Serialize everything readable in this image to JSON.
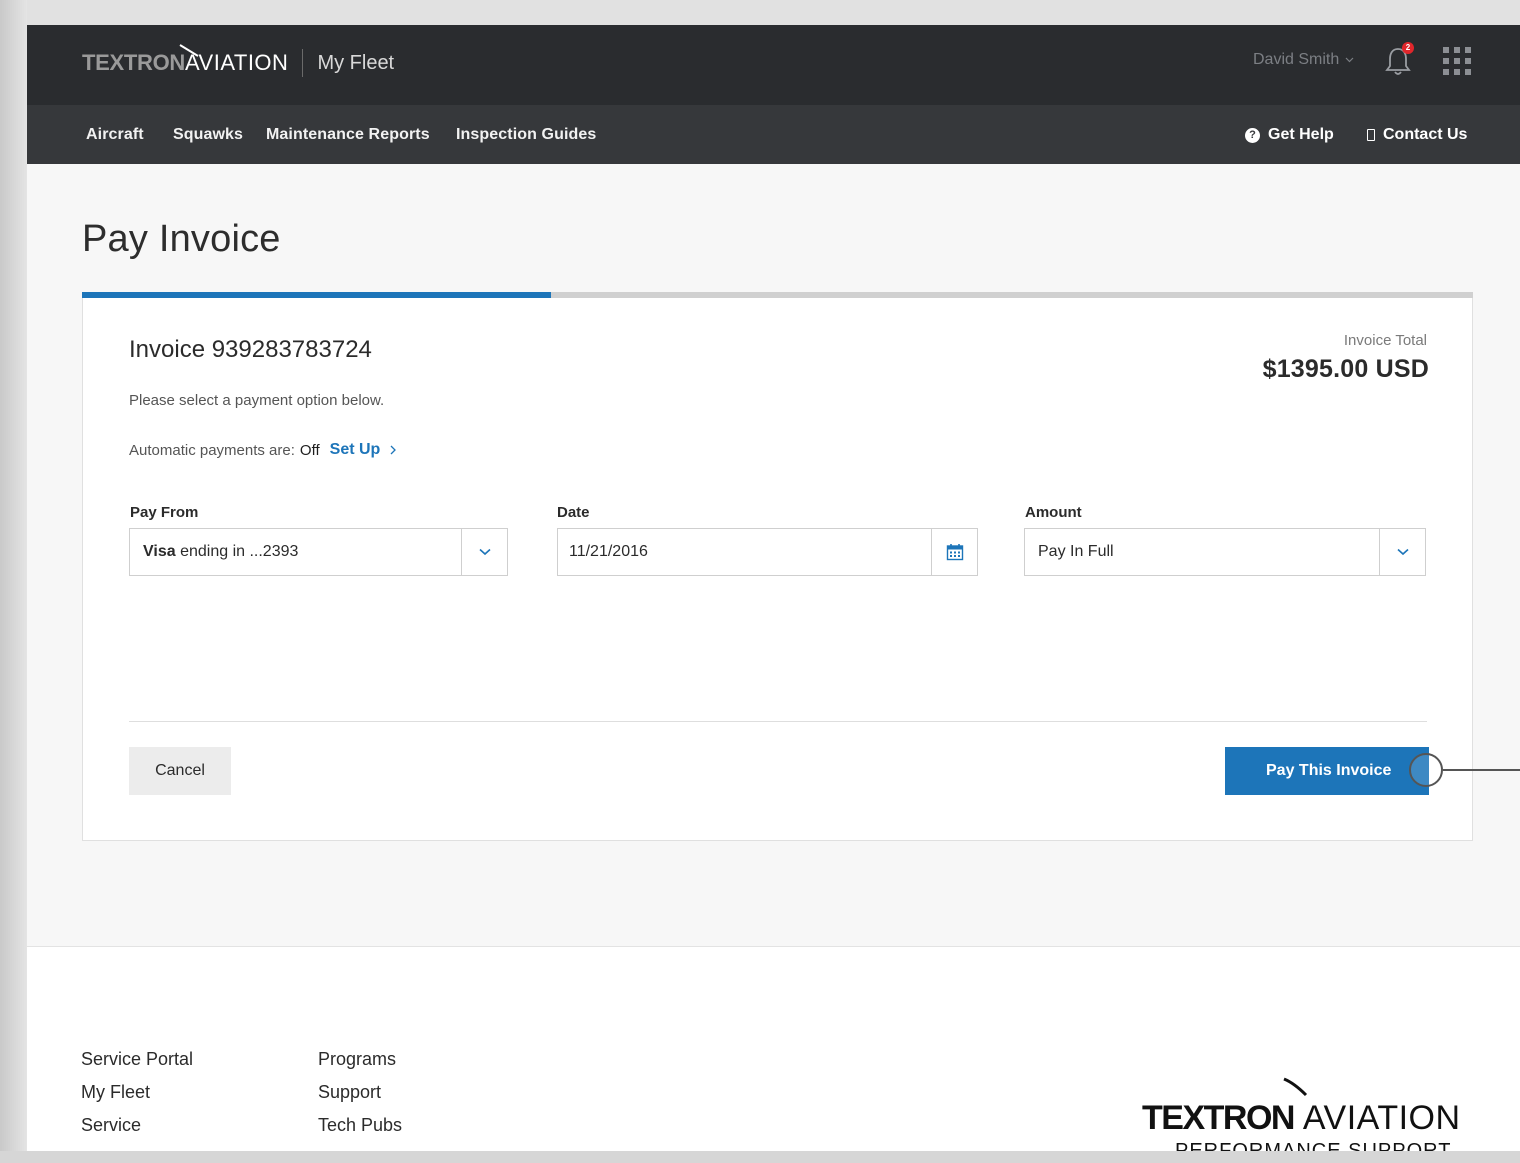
{
  "header": {
    "brand_textron": "TEXTRON",
    "brand_aviation": "AVIATION",
    "app_name": "My Fleet",
    "user_name": "David Smith",
    "notification_count": "2"
  },
  "nav": {
    "items": [
      "Aircraft",
      "Squawks",
      "Maintenance Reports",
      "Inspection Guides"
    ],
    "help_label": "Get Help",
    "contact_label": "Contact Us"
  },
  "page": {
    "title": "Pay Invoice",
    "progress_fraction": 0.337
  },
  "invoice": {
    "title": "Invoice 939283783724",
    "total_label": "Invoice Total",
    "total_value": "$1395.00 USD",
    "hint": "Please select a payment option below.",
    "autopay_label": "Automatic payments are:",
    "autopay_state": "Off",
    "setup_label": "Set Up"
  },
  "form": {
    "pay_from_label": "Pay From",
    "pay_from_brand": "Visa",
    "pay_from_rest": "ending in ...2393",
    "date_label": "Date",
    "date_value": "11/21/2016",
    "amount_label": "Amount",
    "amount_value": "Pay In Full"
  },
  "actions": {
    "cancel_label": "Cancel",
    "pay_label": "Pay This Invoice"
  },
  "footer": {
    "col1": [
      "Service Portal",
      "My Fleet",
      "Service"
    ],
    "col2": [
      "Programs",
      "Support",
      "Tech Pubs"
    ],
    "logo_textron": "TEXTRON",
    "logo_aviation": "AVIATION",
    "logo_sub": "PERFORMANCE SUPPORT"
  },
  "colors": {
    "accent": "#1d75b9",
    "header_bg": "#2a2c2f",
    "nav_bg": "#36383b",
    "badge": "#e0262b"
  },
  "icons": [
    "chevron-down-icon",
    "bell-icon",
    "apps-grid-icon",
    "help-circle-icon",
    "phone-icon",
    "calendar-icon",
    "chevron-right-icon"
  ]
}
